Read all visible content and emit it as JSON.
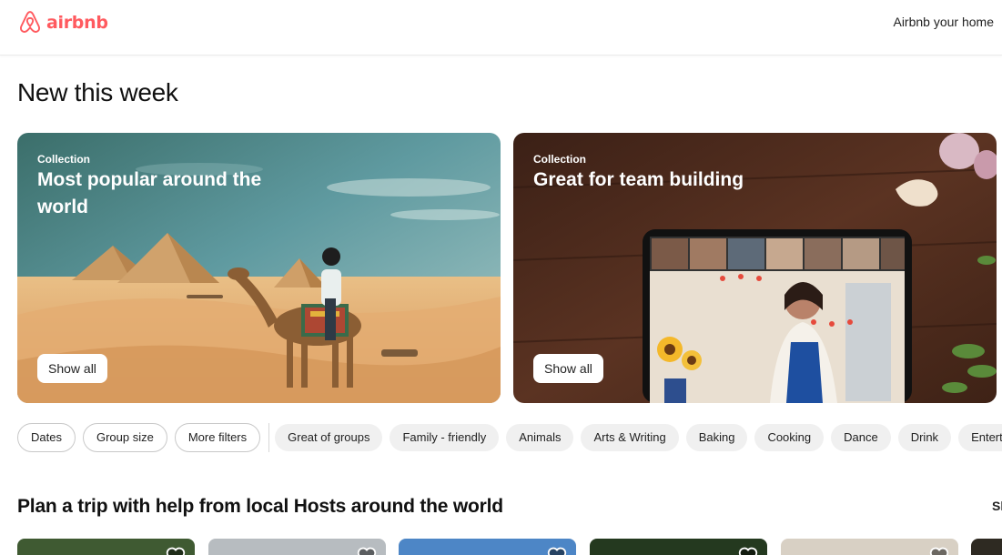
{
  "header": {
    "logo_text": "airbnb",
    "host_link": "Airbnb your home"
  },
  "new_this_week": {
    "title": "New this week",
    "cards": [
      {
        "eyebrow": "Collection",
        "title": "Most popular around the world",
        "button": "Show all"
      },
      {
        "eyebrow": "Collection",
        "title": "Great for team building",
        "button": "Show all"
      }
    ]
  },
  "filters": {
    "pills": [
      "Dates",
      "Group size",
      "More filters"
    ],
    "categories": [
      "Great of groups",
      "Family - friendly",
      "Animals",
      "Arts & Writing",
      "Baking",
      "Cooking",
      "Dance",
      "Drink",
      "Entertainment"
    ]
  },
  "plan": {
    "title": "Plan a trip with help from local Hosts around the world",
    "show_all": "Sh"
  },
  "colors": {
    "brand": "#FF5A5F",
    "pill_border": "#c8c8c8",
    "category_bg": "#f0f0f0"
  },
  "icons": [
    "airbnb-logo-icon",
    "heart-icon"
  ]
}
